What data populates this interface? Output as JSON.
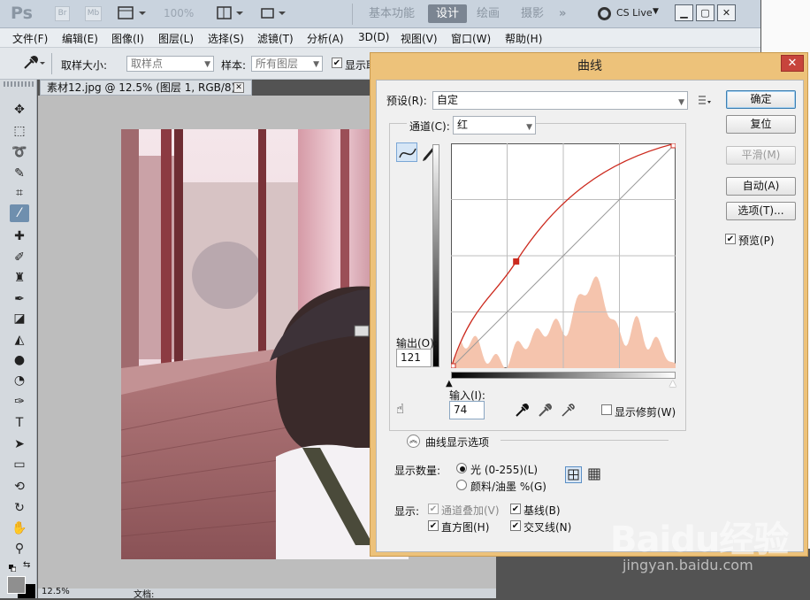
{
  "titlebar": {
    "logo": "Ps",
    "icons": [
      "Br",
      "Mb"
    ],
    "zoom": "100%",
    "workspaces": [
      "基本功能",
      "设计",
      "绘画",
      "摄影"
    ],
    "active_workspace": "设计",
    "more": "»",
    "cslive": "CS Live"
  },
  "menu": [
    "文件(F)",
    "编辑(E)",
    "图像(I)",
    "图层(L)",
    "选择(S)",
    "滤镜(T)",
    "分析(A)",
    "3D(D)",
    "视图(V)",
    "窗口(W)",
    "帮助(H)"
  ],
  "options": {
    "sample_size_label": "取样大小:",
    "sample_size_value": "取样点",
    "sample_label": "样本:",
    "sample_value": "所有图层",
    "show_ring_label": "显示取"
  },
  "document": {
    "tab_title": "素材12.jpg @ 12.5% (图层 1, RGB/8) *",
    "zoom": "12.5%",
    "status": "文档:"
  },
  "dialog": {
    "title": "曲线",
    "preset_label": "预设(R):",
    "preset_value": "自定",
    "channel_label": "通道(C):",
    "channel_value": "红",
    "output_label": "输出(O):",
    "output_value": "121",
    "input_label": "输入(I):",
    "input_value": "74",
    "show_clipping_label": "显示修剪(W)",
    "curve_options_label": "曲线显示选项",
    "show_amount_label": "显示数量:",
    "radio_light": "光 (0-255)(L)",
    "radio_pigment": "颜料/油墨 %(G)",
    "show_label": "显示:",
    "chk_channel_overlay": "通道叠加(V)",
    "chk_baseline": "基线(B)",
    "chk_histogram": "直方图(H)",
    "chk_intersection": "交叉线(N)",
    "btn_ok": "确定",
    "btn_reset": "复位",
    "btn_smooth": "平滑(M)",
    "btn_auto": "自动(A)",
    "btn_options": "选项(T)...",
    "preview_label": "预览(P)",
    "curve_points": [
      [
        0,
        0
      ],
      [
        74,
        121
      ],
      [
        255,
        255
      ]
    ]
  },
  "watermark": {
    "brand": "Baidu经验",
    "url": "jingyan.baidu.com"
  },
  "colors": {
    "dialog_frame": "#edc27a",
    "curve": "#cc2a1e",
    "histogram": "#f5c4ad",
    "ps_accent": "#6f8fae"
  }
}
